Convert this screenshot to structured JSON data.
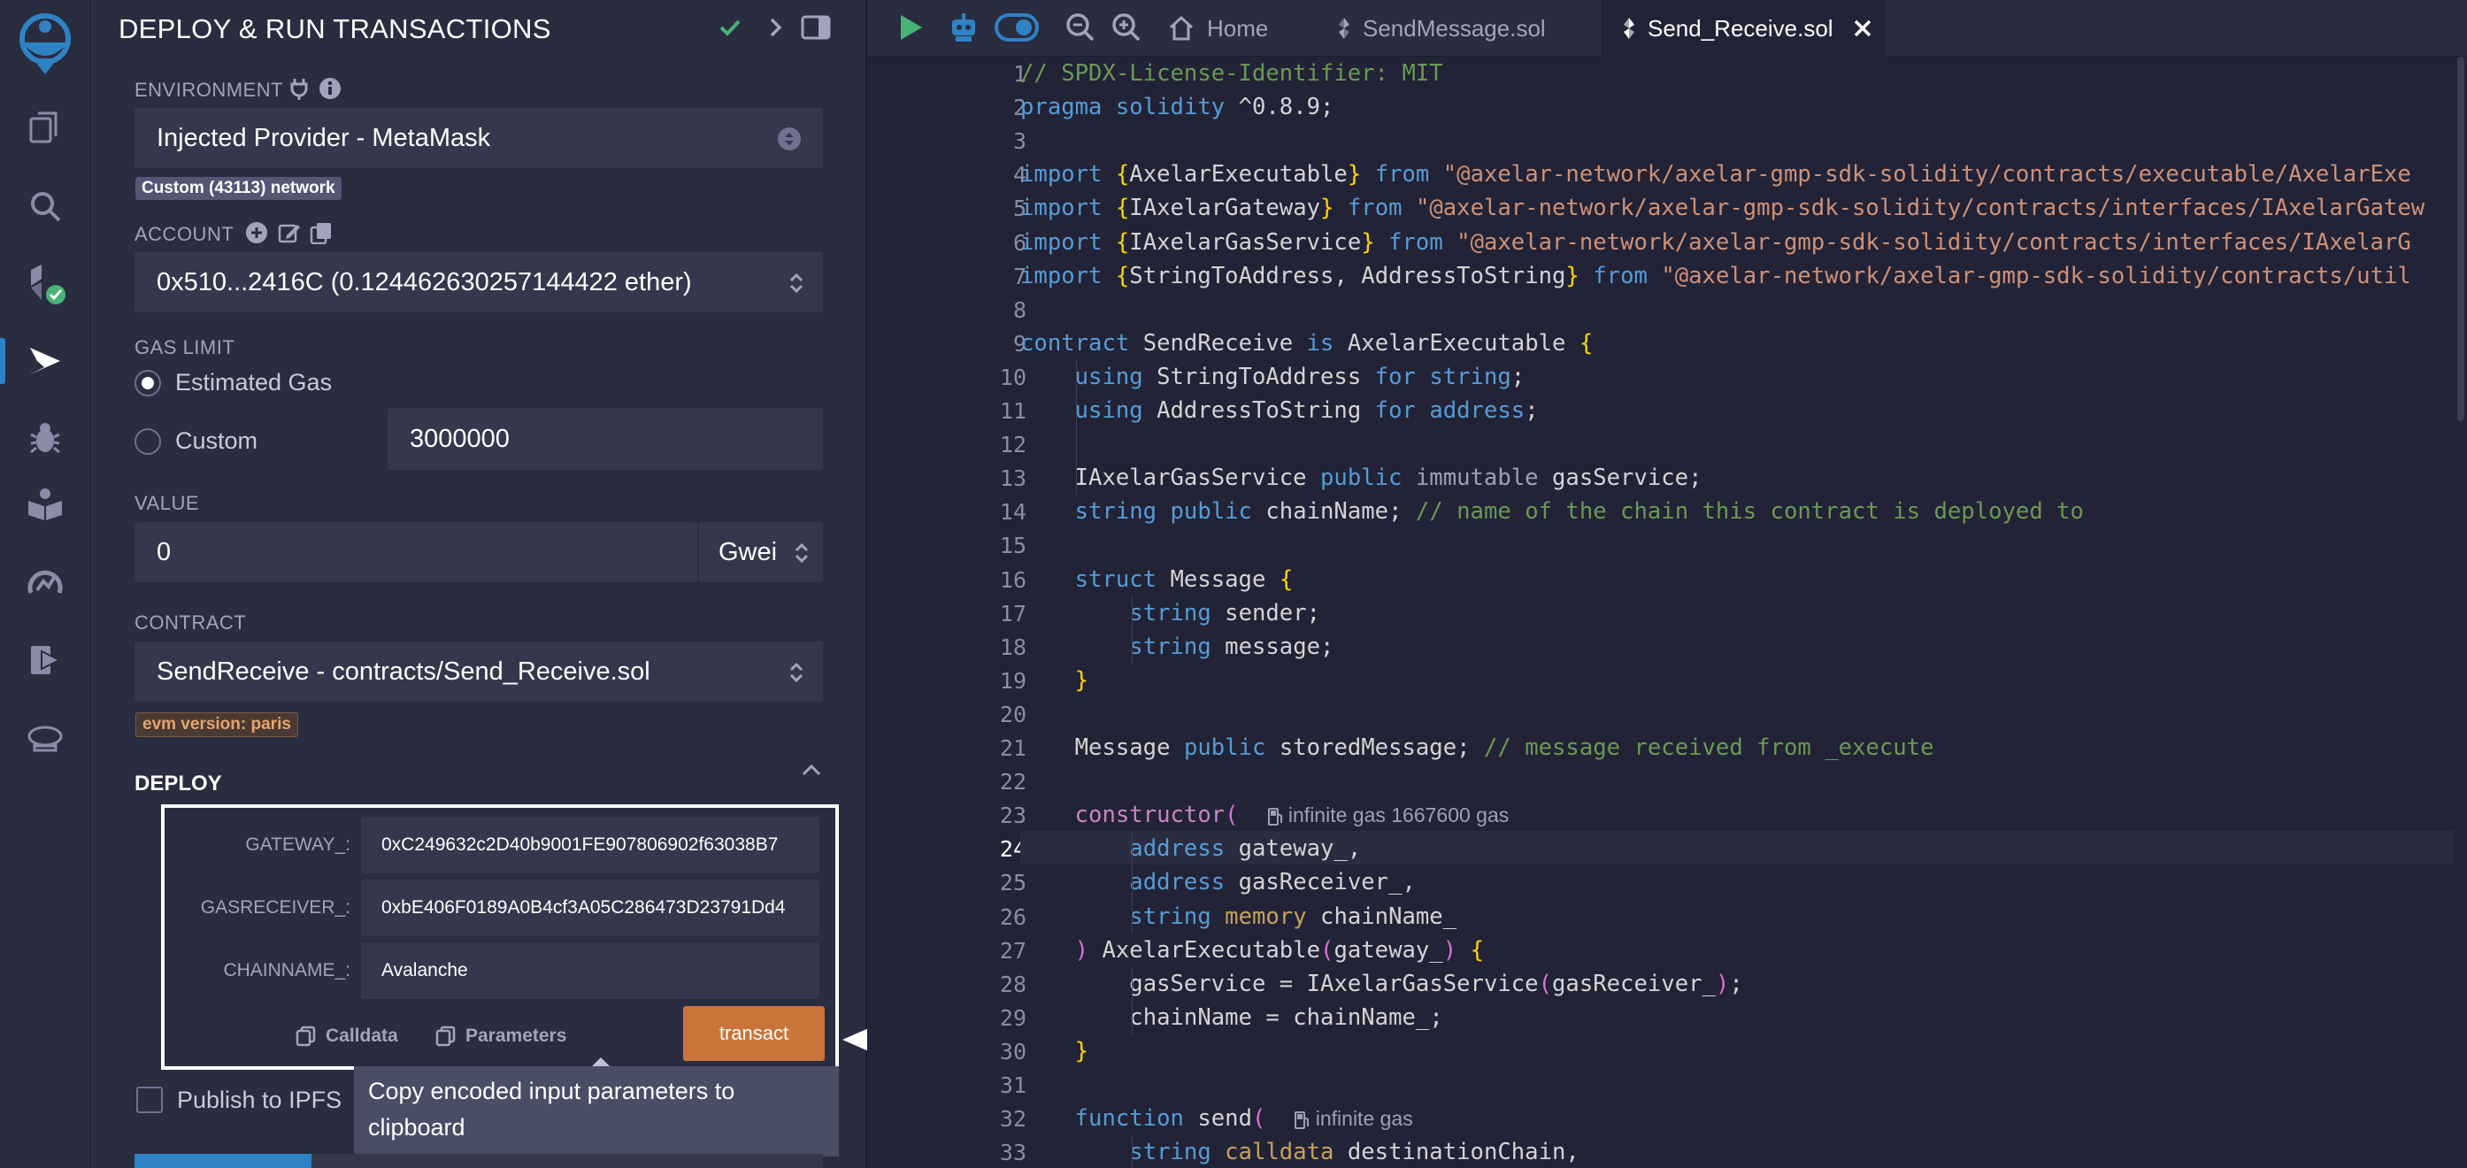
{
  "sidebar_icons": [
    {
      "name": "remix-logo-icon"
    },
    {
      "name": "file-explorer-icon"
    },
    {
      "name": "search-icon"
    },
    {
      "name": "solidity-compiler-icon"
    },
    {
      "name": "deploy-run-icon"
    },
    {
      "name": "debugger-icon"
    },
    {
      "name": "learneth-icon"
    },
    {
      "name": "analysis-icon"
    },
    {
      "name": "run-script-icon"
    },
    {
      "name": "chef-hat-icon"
    }
  ],
  "panel": {
    "title": "DEPLOY & RUN TRANSACTIONS",
    "environment_label": "ENVIRONMENT",
    "environment_value": "Injected Provider - MetaMask",
    "network_badge": "Custom (43113) network",
    "account_label": "ACCOUNT",
    "account_value": "0x510...2416C (0.124462630257144422 ether)",
    "gas_limit_label": "GAS LIMIT",
    "gas_estimated_label": "Estimated Gas",
    "gas_custom_label": "Custom",
    "gas_custom_value": "3000000",
    "value_label": "VALUE",
    "value_amount": "0",
    "value_unit": "Gwei",
    "contract_label": "CONTRACT",
    "contract_value": "SendReceive - contracts/Send_Receive.sol",
    "evm_badge": "evm version: paris",
    "deploy_label": "DEPLOY",
    "params": [
      {
        "label": "GATEWAY_:",
        "value": "0xC249632c2D40b9001FE907806902f63038B7"
      },
      {
        "label": "GASRECEIVER_:",
        "value": "0xbE406F0189A0B4cf3A05C286473D23791Dd4"
      },
      {
        "label": "CHAINNAME_:",
        "value": "Avalanche"
      }
    ],
    "calldata_label": "Calldata",
    "parameters_label": "Parameters",
    "transact_label": "transact",
    "publish_label": "Publish to IPFS",
    "tooltip": "Copy encoded input parameters to clipboard"
  },
  "tabs": {
    "home": "Home",
    "file1": "SendMessage.sol",
    "file2": "Send_Receive.sol"
  },
  "code_lines": [
    "// SPDX-License-Identifier: MIT",
    "pragma solidity ^0.8.9;",
    "",
    "import {AxelarExecutable} from \"@axelar-network/axelar-gmp-sdk-solidity/contracts/executable/AxelarExe",
    "import {IAxelarGateway} from \"@axelar-network/axelar-gmp-sdk-solidity/contracts/interfaces/IAxelarGatew",
    "import {IAxelarGasService} from \"@axelar-network/axelar-gmp-sdk-solidity/contracts/interfaces/IAxelarG",
    "import {StringToAddress, AddressToString} from \"@axelar-network/axelar-gmp-sdk-solidity/contracts/util",
    "",
    "contract SendReceive is AxelarExecutable {",
    "    using StringToAddress for string;",
    "    using AddressToString for address;",
    "",
    "    IAxelarGasService public immutable gasService;",
    "    string public chainName; // name of the chain this contract is deployed to",
    "",
    "    struct Message {",
    "        string sender;",
    "        string message;",
    "    }",
    "",
    "    Message public storedMessage; // message received from _execute",
    "",
    "    constructor(",
    "        address gateway_,",
    "        address gasReceiver_,",
    "        string memory chainName_",
    "    ) AxelarExecutable(gateway_) {",
    "        gasService = IAxelarGasService(gasReceiver_);",
    "        chainName = chainName_;",
    "    }",
    "",
    "    function send(",
    "        string calldata destinationChain,"
  ],
  "line_numbers": [
    "1",
    "2",
    "3",
    "4",
    "5",
    "6",
    "7",
    "8",
    "9",
    "10",
    "11",
    "12",
    "13",
    "14",
    "15",
    "16",
    "17",
    "18",
    "19",
    "20",
    "21",
    "22",
    "23",
    "24",
    "25",
    "26",
    "27",
    "28",
    "29",
    "30",
    "31",
    "32",
    "33"
  ],
  "gas_hints": {
    "constructor": "infinite gas 1667600 gas",
    "send": "infinite gas"
  },
  "colors": {
    "accent": "#2f83c5",
    "transact": "#c97539",
    "check": "#49b376"
  }
}
